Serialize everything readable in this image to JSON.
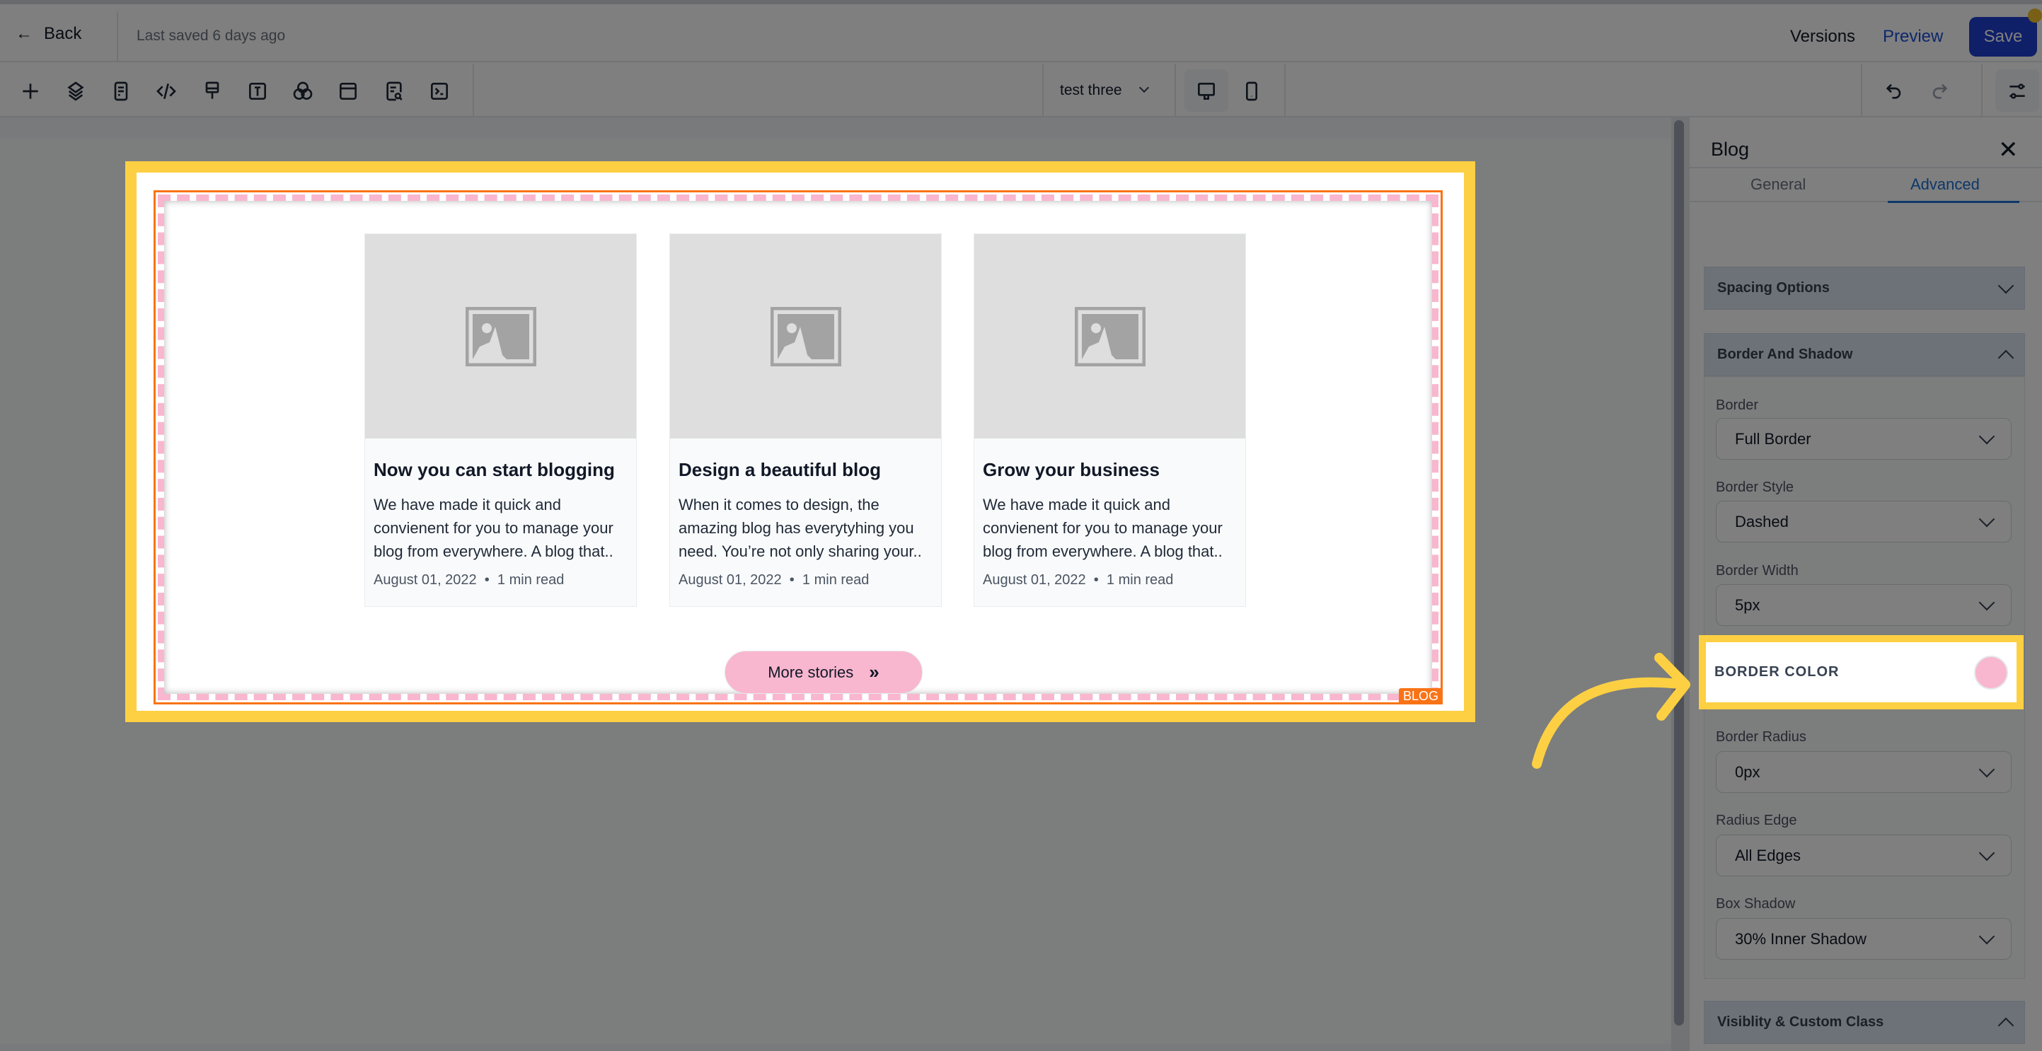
{
  "header": {
    "back_label": "Back",
    "last_saved": "Last saved 6 days ago",
    "versions_label": "Versions",
    "preview_label": "Preview",
    "save_label": "Save"
  },
  "toolbar": {
    "icons": [
      "plus-icon",
      "layers-icon",
      "page-icon",
      "code-icon",
      "brush-icon",
      "text-icon",
      "color-circles-icon",
      "section-icon",
      "page-search-icon",
      "terminal-icon"
    ],
    "page_select": "test three"
  },
  "blog": {
    "tag": "BLOG",
    "cards": [
      {
        "title": "Now you can start blogging",
        "description": "We have made it quick and convienent for you to manage your blog from everywhere. A blog that..",
        "date": "August 01, 2022",
        "read": "1 min read"
      },
      {
        "title": "Design a beautiful blog",
        "description": "When it comes to design, the amazing blog has everytyhing you need. You’re not only sharing your..",
        "date": "August 01, 2022",
        "read": "1 min read"
      },
      {
        "title": "Grow your business",
        "description": "We have made it quick and convienent for you to manage your blog from everywhere. A blog that..",
        "date": "August 01, 2022",
        "read": "1 min read"
      }
    ],
    "more_label": "More stories",
    "border_color": "#f9b6cf"
  },
  "panel": {
    "title": "Blog",
    "tabs": [
      {
        "label": "General"
      },
      {
        "label": "Advanced",
        "active": true
      }
    ],
    "spacing_header": "Spacing Options",
    "border_header": "Border And Shadow",
    "fields": {
      "border": {
        "label": "Border",
        "value": "Full Border"
      },
      "border_style": {
        "label": "Border Style",
        "value": "Dashed"
      },
      "border_width": {
        "label": "Border Width",
        "value": "5px"
      },
      "border_color": {
        "label": "BORDER COLOR",
        "value": "#f9b6cf"
      },
      "border_radius": {
        "label": "Border Radius",
        "value": "0px"
      },
      "radius_edge": {
        "label": "Radius Edge",
        "value": "All Edges"
      },
      "box_shadow": {
        "label": "Box Shadow",
        "value": "30% Inner Shadow"
      }
    },
    "visibility_header": "Visiblity & Custom Class"
  },
  "colors": {
    "highlight": "#fdd043",
    "accent": "#1e3fd0",
    "selection_outline": "#f97316"
  }
}
